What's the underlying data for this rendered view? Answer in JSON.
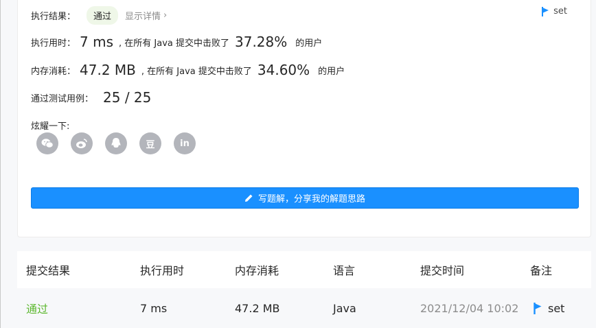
{
  "result": {
    "label": "执行结果：",
    "status": "通过",
    "detail_link": "显示详情",
    "chevron": "›",
    "note_flag": "set"
  },
  "runtime": {
    "label": "执行用时：",
    "value": "7 ms",
    "prefix": ", 在所有 Java 提交中击败了",
    "percent": "37.28%",
    "suffix": "的用户"
  },
  "memory": {
    "label": "内存消耗：",
    "value": "47.2 MB",
    "prefix": ", 在所有 Java 提交中击败了",
    "percent": "34.60%",
    "suffix": "的用户"
  },
  "testcases": {
    "label": "通过测试用例：",
    "value": "25 / 25"
  },
  "share": {
    "label": "炫耀一下:",
    "icons": [
      "wechat-icon",
      "weibo-icon",
      "qq-icon",
      "douban-icon",
      "linkedin-icon"
    ],
    "douban_glyph": "豆",
    "linkedin_glyph": "in"
  },
  "write_solution": {
    "label": "写题解，分享我的解题思路"
  },
  "submissions": {
    "headers": [
      "提交结果",
      "执行用时",
      "内存消耗",
      "语言",
      "提交时间",
      "备注"
    ],
    "rows": [
      {
        "result": "通过",
        "runtime": "7 ms",
        "memory": "47.2 MB",
        "language": "Java",
        "time": "2021/12/04 10:02",
        "note": "set"
      }
    ]
  },
  "colors": {
    "accent": "#1a90ff",
    "success": "#5cb82e",
    "icon_gray": "#b3b5bb"
  }
}
